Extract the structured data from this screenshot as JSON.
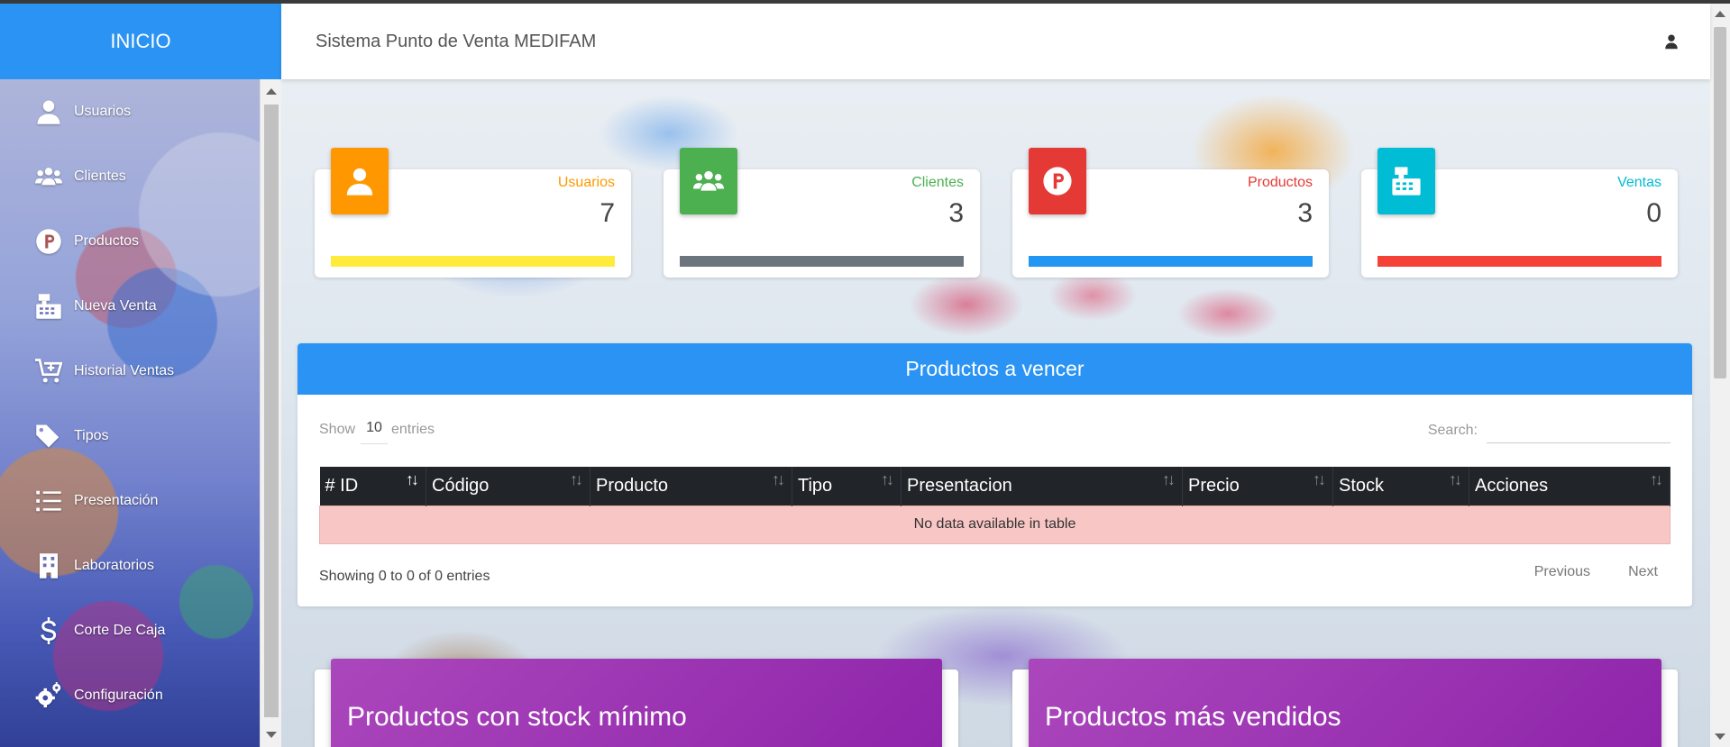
{
  "sidebar": {
    "header": "INICIO",
    "items": [
      {
        "label": "Usuarios",
        "icon": "user-icon"
      },
      {
        "label": "Clientes",
        "icon": "users-icon"
      },
      {
        "label": "Productos",
        "icon": "product-p-icon"
      },
      {
        "label": "Nueva Venta",
        "icon": "cash-register-icon"
      },
      {
        "label": "Historial Ventas",
        "icon": "cart-plus-icon"
      },
      {
        "label": "Tipos",
        "icon": "tags-icon"
      },
      {
        "label": "Presentación",
        "icon": "list-icon"
      },
      {
        "label": "Laboratorios",
        "icon": "building-icon"
      },
      {
        "label": "Corte De Caja",
        "icon": "dollar-icon"
      },
      {
        "label": "Configuración",
        "icon": "gears-icon"
      }
    ]
  },
  "topbar": {
    "title": "Sistema Punto de Venta MEDIFAM",
    "user_icon": "user-icon"
  },
  "stats": [
    {
      "label": "Usuarios",
      "value": "7",
      "icon": "user-icon",
      "icon_color": "#ff9800",
      "label_color": "#ff9800",
      "bar_color": "#ffeb3b"
    },
    {
      "label": "Clientes",
      "value": "3",
      "icon": "users-icon",
      "icon_color": "#4caf50",
      "label_color": "#4caf50",
      "bar_color": "#6c757d"
    },
    {
      "label": "Productos",
      "value": "3",
      "icon": "product-p-icon",
      "icon_color": "#e53935",
      "label_color": "#e53935",
      "bar_color": "#2196f3"
    },
    {
      "label": "Ventas",
      "value": "0",
      "icon": "cash-register-icon",
      "icon_color": "#00bcd4",
      "label_color": "#00bcd4",
      "bar_color": "#f44336"
    }
  ],
  "expiring": {
    "title": "Productos a vencer",
    "show_label": "Show",
    "show_value": "10",
    "entries_label": "entries",
    "search_label": "Search:",
    "search_placeholder": "",
    "columns": [
      "# ID",
      "Código",
      "Producto",
      "Tipo",
      "Presentacion",
      "Precio",
      "Stock",
      "Acciones"
    ],
    "empty_message": "No data available in table",
    "info": "Showing 0 to 0 of 0 entries",
    "previous": "Previous",
    "next": "Next"
  },
  "bottom_panels": {
    "min_stock_title": "Productos con stock mínimo",
    "best_sellers_title": "Productos más vendidos"
  },
  "colors": {
    "primary": "#2a93f3",
    "purple": "#9c27b0",
    "table_head": "#212529",
    "empty_row": "#f8c6c4"
  }
}
